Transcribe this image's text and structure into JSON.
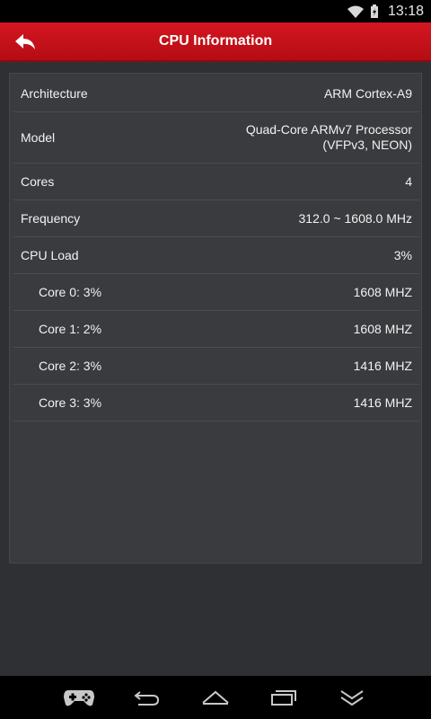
{
  "status_bar": {
    "time": "13:18"
  },
  "header": {
    "title": "CPU Information"
  },
  "rows": [
    {
      "label": "Architecture",
      "value_lines": [
        "ARM Cortex-A9"
      ]
    },
    {
      "label": "Model",
      "value_lines": [
        "Quad-Core ARMv7 Processor",
        "(VFPv3, NEON)"
      ]
    },
    {
      "label": "Cores",
      "value_lines": [
        "4"
      ]
    },
    {
      "label": "Frequency",
      "value_lines": [
        "312.0 ~ 1608.0 MHz"
      ]
    },
    {
      "label": "CPU Load",
      "value_lines": [
        "3%"
      ]
    },
    {
      "label": "Core 0: 3%",
      "value_lines": [
        "1608 MHZ"
      ]
    },
    {
      "label": "Core 1: 2%",
      "value_lines": [
        "1608 MHZ"
      ]
    },
    {
      "label": "Core 2: 3%",
      "value_lines": [
        "1416 MHZ"
      ]
    },
    {
      "label": "Core 3: 3%",
      "value_lines": [
        "1416 MHZ"
      ]
    }
  ],
  "nav_icons": [
    "gamepad-icon",
    "back-icon",
    "home-icon",
    "recents-icon",
    "collapse-icon"
  ]
}
